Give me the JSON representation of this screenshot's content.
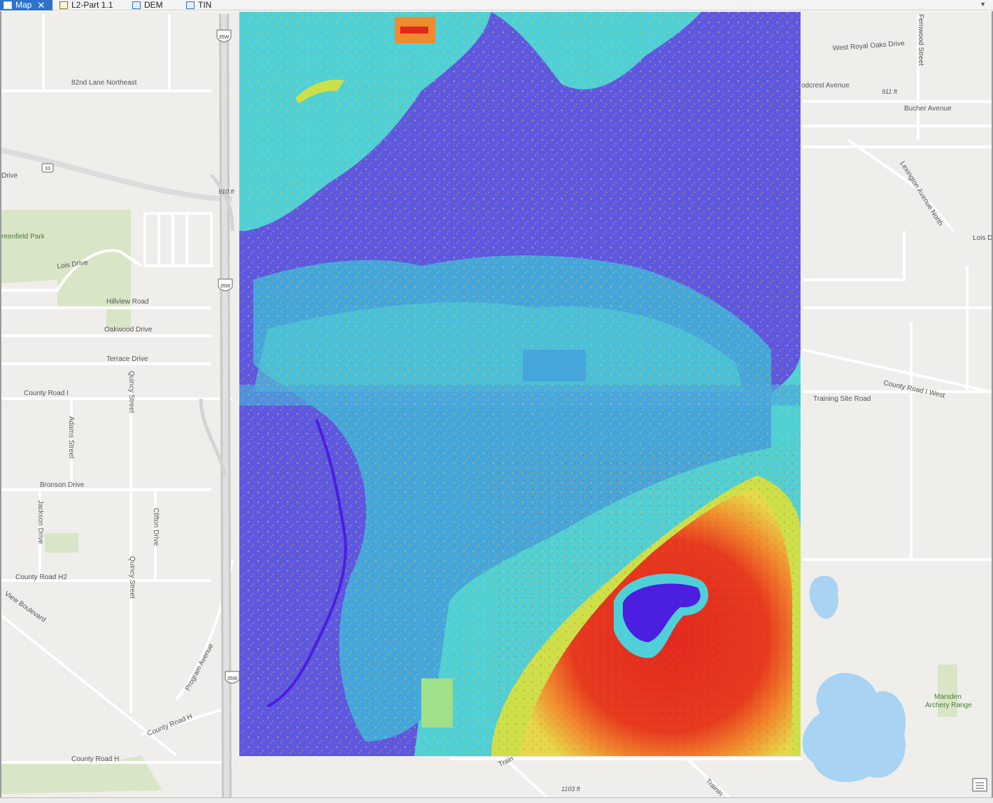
{
  "tabs": [
    {
      "label": "Map",
      "icon": "map-icon",
      "active": true,
      "closable": true
    },
    {
      "label": "L2-Part 1.1",
      "icon": "layout-icon",
      "active": false
    },
    {
      "label": "DEM",
      "icon": "raster-icon",
      "active": false
    },
    {
      "label": "TIN",
      "icon": "tin-icon",
      "active": false
    }
  ],
  "basemap_labels": {
    "road_82nd": "82nd Lane Northeast",
    "drive_w": "Drive",
    "greenfield_park": "reenfield Park",
    "lois_drive": "Lois Drive",
    "hillview": "Hillview Road",
    "oakwood": "Oakwood Drive",
    "terrace": "Terrace Drive",
    "county_i": "County Road I",
    "quincy_1": "Quincy Street",
    "adams": "Adams Street",
    "bronson": "Bronson Drive",
    "jackson": "Jackson Drive",
    "clifton": "Clifton Drive",
    "county_h2": "County Road H2",
    "quincy_2": "Quincy Street",
    "view_blvd": "View Boulevard",
    "program_ave": "Program Avenue",
    "county_h_diag": "County Road H",
    "county_h": "County Road H",
    "elev_910": "910 ft",
    "west_royal_oaks": "West Royal Oaks Drive",
    "woodcrest": "odcrest Avenue",
    "elev_911": "911 ft",
    "bucher": "Bucher Avenue",
    "fernwood": "Fernwood Street",
    "lexington": "Lexington Avenue North",
    "lois_e": "Lois D",
    "county_i_west": "County Road I West",
    "training_site": "Training Site Road",
    "marsden": "Marsden",
    "archery": "Archery Range",
    "elev_1103": "1103 ft",
    "train_1": "Train",
    "train_2": "Trainin"
  },
  "shields": {
    "i35w": "35W",
    "us10": "10"
  },
  "dem_colors": {
    "low": "#5e57e0",
    "mid_low": "#45a6dc",
    "mid": "#4fd0d6",
    "mid_high": "#cde04a",
    "high_orange": "#f08a2e",
    "high": "#e2281e"
  }
}
